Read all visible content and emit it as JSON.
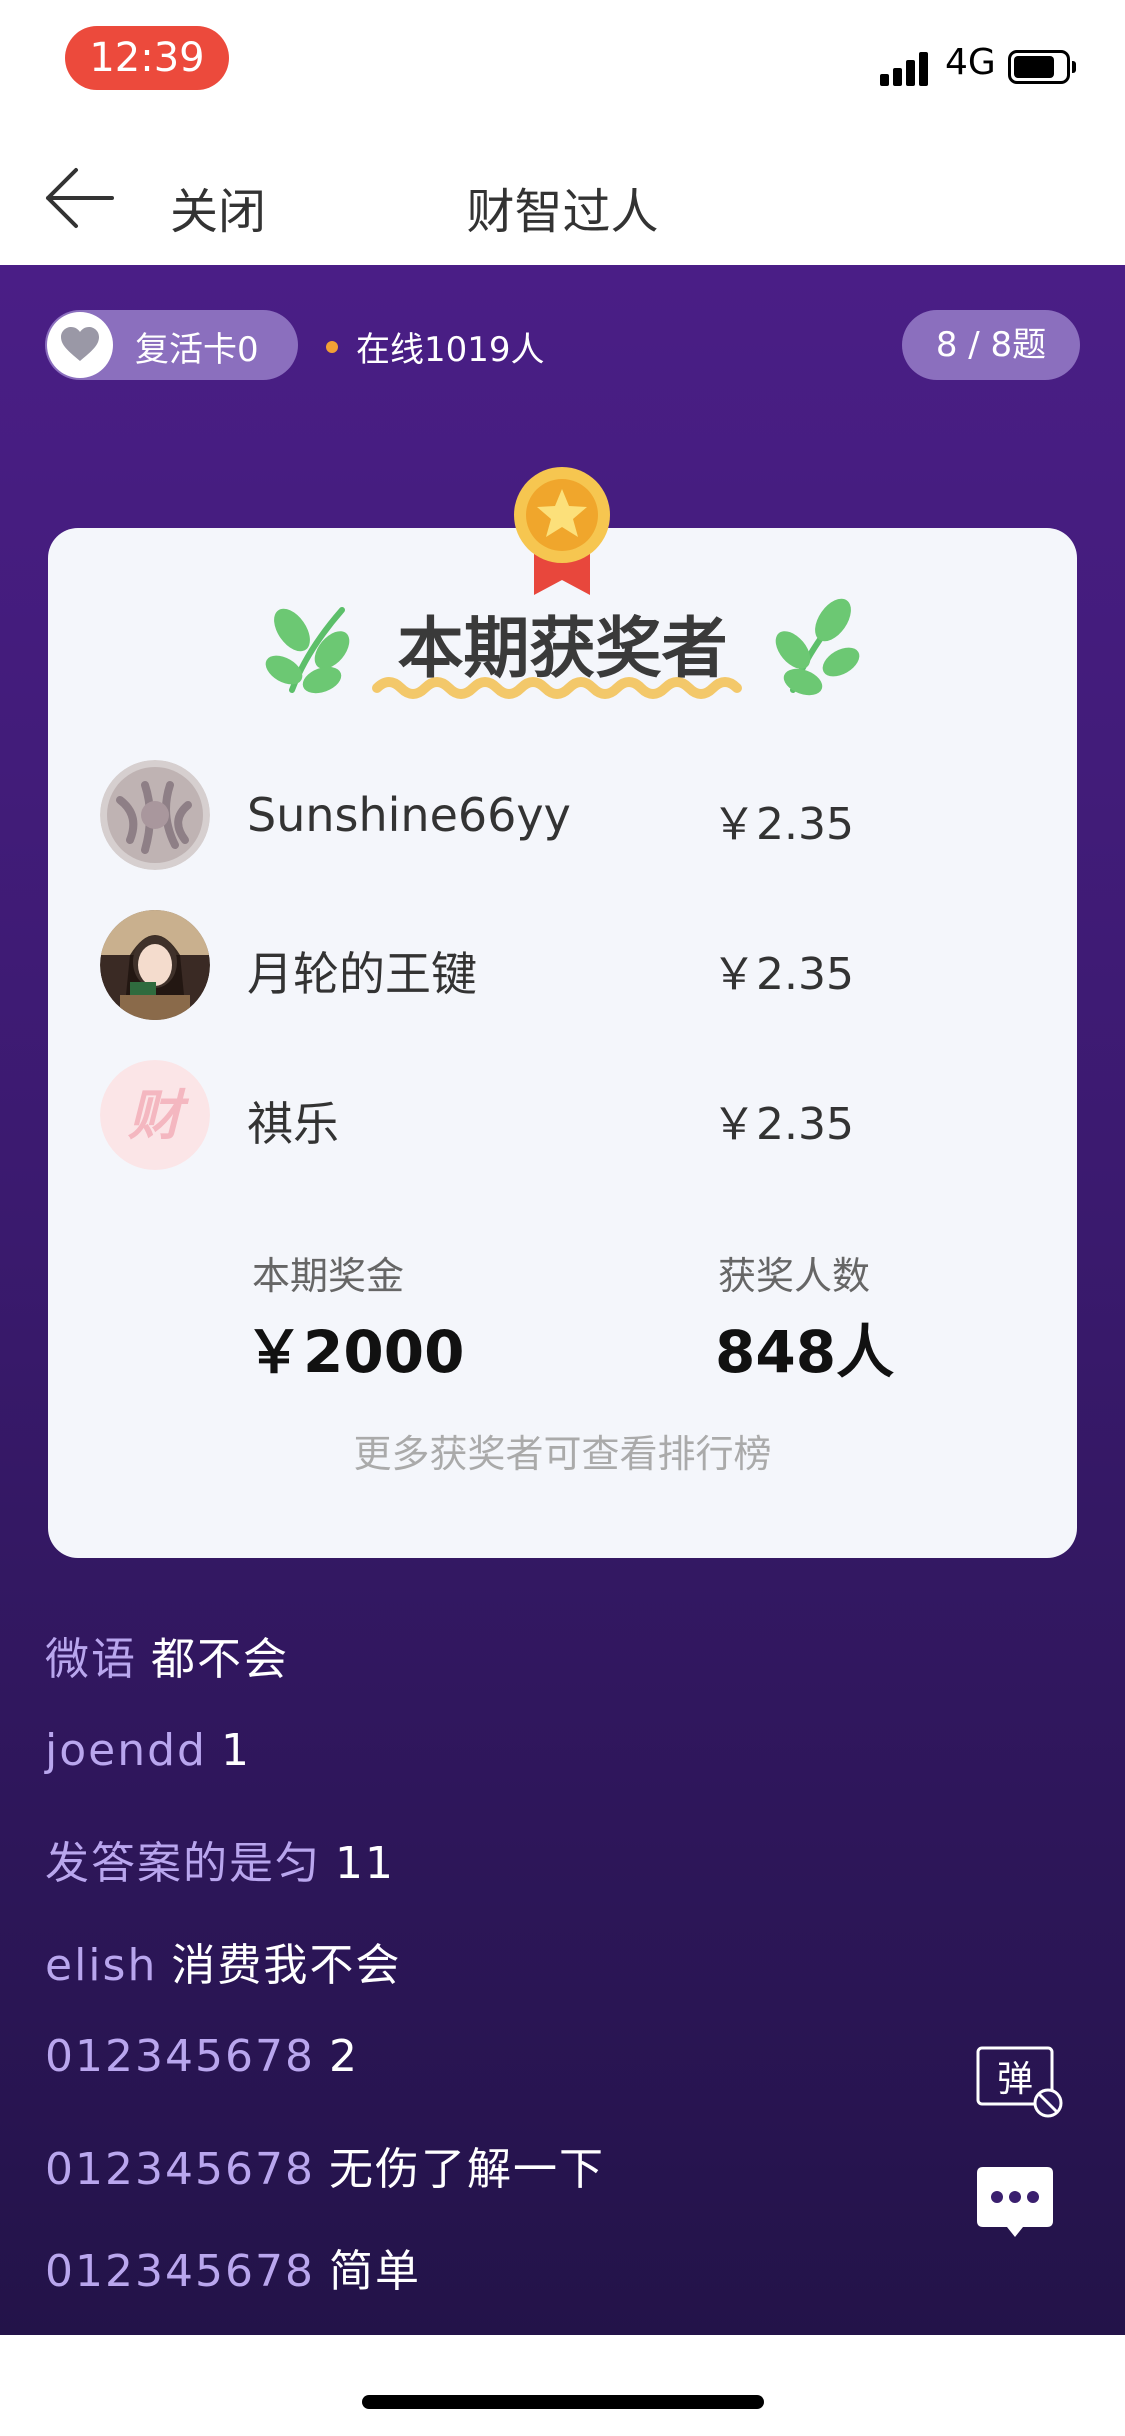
{
  "status_bar": {
    "time": "12:39",
    "network": "4G"
  },
  "nav": {
    "close_label": "关闭",
    "title": "财智过人"
  },
  "top_info": {
    "revive_card": "复活卡0",
    "online": "在线1019人",
    "question_progress": "8 / 8题"
  },
  "winners_card": {
    "title": "本期获奖者",
    "winners": [
      {
        "name": "Sunshine66yy",
        "amount": "￥2.35",
        "avatar": "octopus-photo-avatar"
      },
      {
        "name": "月轮的王键",
        "amount": "￥2.35",
        "avatar": "girl-photo-avatar"
      },
      {
        "name": "祺乐",
        "amount": "￥2.35",
        "avatar": "default-cai-avatar",
        "avatar_text": "财"
      }
    ],
    "prize_label": "本期奖金",
    "prize_value": "￥2000",
    "winners_count_label": "获奖人数",
    "winners_count_value": "848人",
    "more_text": "更多获奖者可查看排行榜"
  },
  "chat_messages": [
    {
      "user": "微语",
      "message": "都不会"
    },
    {
      "user": "joendd",
      "message": "1"
    },
    {
      "user": "发答案的是匀",
      "message": "11"
    },
    {
      "user": "elish",
      "message": "消费我不会"
    },
    {
      "user": "012345678",
      "message": "2"
    },
    {
      "user": "012345678",
      "message": "无伤了解一下"
    },
    {
      "user": "012345678",
      "message": "简单"
    }
  ],
  "danmaku_button": {
    "label": "弹"
  },
  "colors": {
    "accent_red": "#ec4a3c",
    "purple_top": "#4a1e86",
    "purple_bottom": "#231349",
    "pill": "#8b6fbe",
    "chat_user": "#b9a6ee"
  }
}
